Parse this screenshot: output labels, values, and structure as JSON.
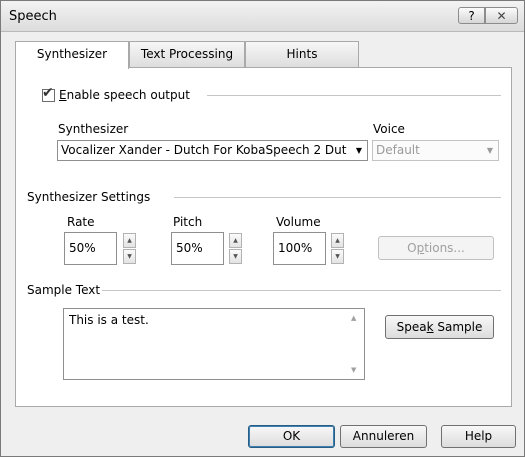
{
  "window": {
    "title": "Speech",
    "help_glyph": "?",
    "close_glyph": "✕"
  },
  "tabs": [
    {
      "label": "Synthesizer",
      "active": true
    },
    {
      "label": "Text Processing",
      "active": false
    },
    {
      "label": "Hints",
      "active": false
    }
  ],
  "enable": {
    "checked": true,
    "check_glyph": "✔",
    "label_prefix": "E",
    "label_rest": "nable speech output"
  },
  "synth": {
    "label": "Synthesizer",
    "value": "Vocalizer Xander - Dutch For KobaSpeech 2 Dut",
    "arrow": "▼",
    "voice_label": "Voice",
    "voice_value": "Default",
    "voice_arrow": "▼"
  },
  "settings": {
    "section_label": "Synthesizer Settings",
    "rate_label": "Rate",
    "rate_value": "50%",
    "pitch_label": "Pitch",
    "pitch_value": "50%",
    "volume_label": "Volume",
    "volume_value": "100%",
    "spin_up": "▲",
    "spin_down": "▼",
    "options_prefix": "O",
    "options_key": "p",
    "options_rest": "tions..."
  },
  "sample": {
    "section_label": "Sample Text",
    "text": "This is a test.",
    "scroll_up": "▲",
    "scroll_down": "▼",
    "speak_prefix": "Spea",
    "speak_key": "k",
    "speak_rest": " Sample"
  },
  "footer": {
    "ok_label": "OK",
    "cancel_label": "Annuleren",
    "help_label": "Help"
  }
}
